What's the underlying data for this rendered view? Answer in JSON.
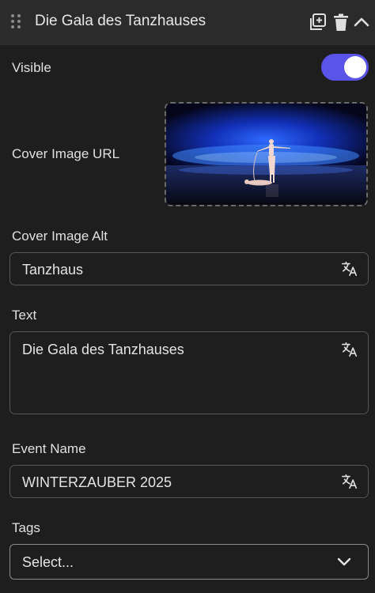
{
  "header": {
    "title": "Die Gala des Tanzhauses"
  },
  "visible": {
    "label": "Visible",
    "enabled": true
  },
  "cover_image": {
    "label": "Cover Image URL"
  },
  "cover_image_alt": {
    "label": "Cover Image Alt",
    "value": "Tanzhaus"
  },
  "text": {
    "label": "Text",
    "value": "Die Gala des Tanzhauses"
  },
  "event_name": {
    "label": "Event Name",
    "value": "WINTERZAUBER 2025"
  },
  "tags": {
    "label": "Tags",
    "placeholder": "Select..."
  },
  "colors": {
    "toggle_on": "#5b54e8",
    "background": "#1e1e1e",
    "header_bg": "#2b2b2b"
  }
}
